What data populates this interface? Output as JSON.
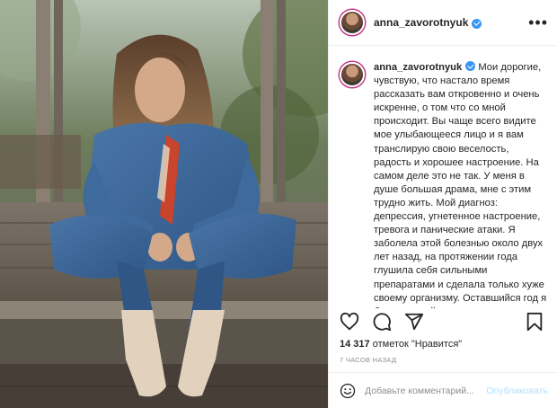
{
  "post": {
    "username": "anna_zavorotnyuk",
    "more_label": "•••",
    "caption": "Мои дорогие, чувствую, что настало время рассказать вам откровенно и очень искренне, о том что со мной происходит. Вы чаще всего видите мое улыбающееся лицо и я вам транслирую свою веселость, радость и хорошее настроение. На самом деле это не так. У меня в душе большая драма, мне с этим трудно жить. Мой диагноз: депрессия, угнетенное настроение, тревога и панические атаки. Я заболела этой болезнью около двух лет назад, на протяжении года глушила себя сильными препаратами и сделала только хуже своему организму. Оставшийся год я борюсь с ней с помощью специалистов. Я отказалась от",
    "likes_count": "14 317",
    "likes_suffix": " отметок \"Нравится\"",
    "time_ago": "7 ЧАСОВ НАЗАД",
    "comment_placeholder": "Добавьте комментарий...",
    "publish_label": "Опубликовать"
  },
  "icons": {
    "like": "heart-icon",
    "comment": "comment-icon",
    "share": "share-icon",
    "save": "bookmark-icon",
    "emoji": "emoji-icon",
    "verified": "verified-badge-icon"
  },
  "colors": {
    "verified": "#3897f0",
    "publish_disabled": "#b2dffc",
    "muted_text": "#8e8e8e",
    "border": "#efefef"
  }
}
